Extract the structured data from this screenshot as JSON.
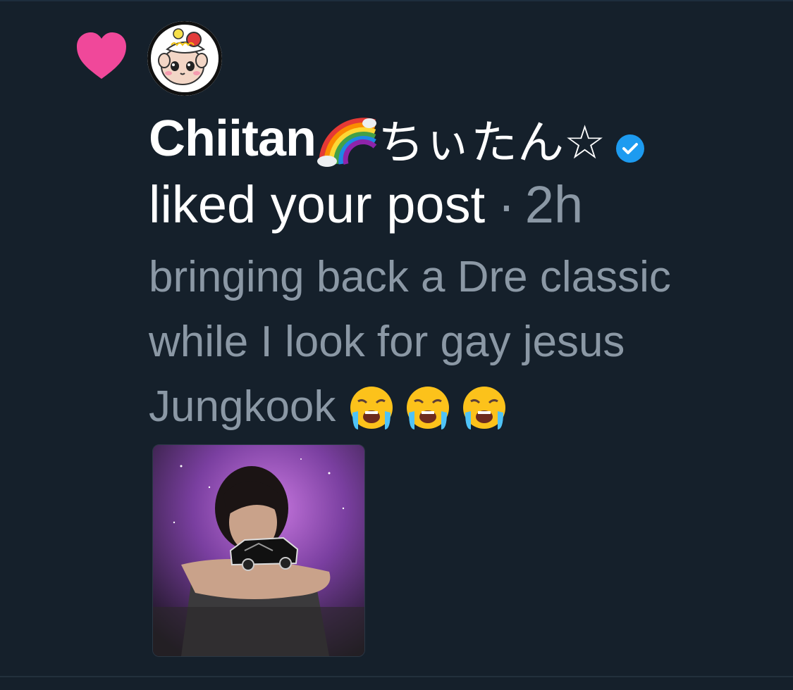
{
  "notification": {
    "user": {
      "display_name": "Chiitan",
      "jp_name": "ちぃたん☆",
      "rainbow_icon": "rainbow-emoji",
      "verified": true
    },
    "action": "liked your post",
    "separator": "·",
    "time": "2h",
    "post": {
      "lines": [
        "bringing back a Dre  classic",
        "while I look for gay jesus",
        "Jungkook"
      ],
      "emojis": [
        "loudly-crying-face",
        "loudly-crying-face",
        "loudly-crying-face"
      ]
    },
    "media": {
      "type": "image",
      "icon": "photo-thumbnail"
    }
  },
  "colors": {
    "background": "#15202b",
    "heart": "#f0489a",
    "verified": "#1d9bf0",
    "primary_text": "#ffffff",
    "secondary_text": "#8b98a5"
  }
}
